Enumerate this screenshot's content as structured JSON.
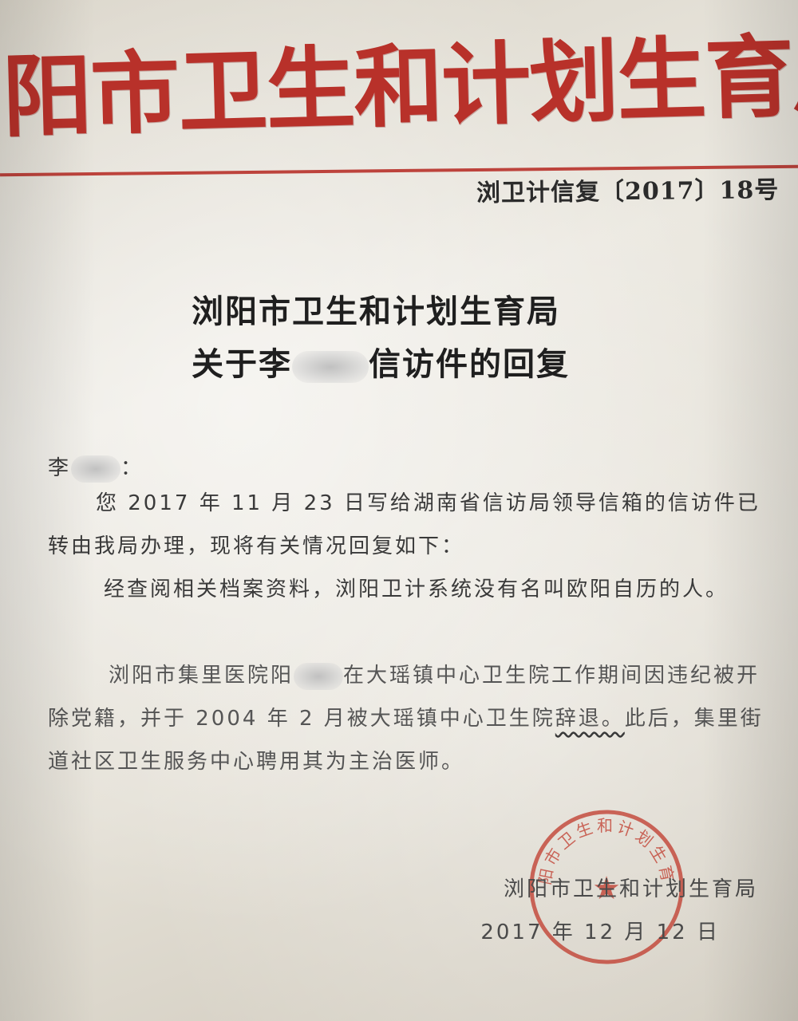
{
  "letterhead": {
    "agency_name": "浏阳市卫生和计划生育局",
    "doc_number": "浏卫计信复〔2017〕18号"
  },
  "title": {
    "line1": "浏阳市卫生和计划生育局",
    "line2_prefix": "关于李",
    "line2_suffix": "信访件的回复"
  },
  "body": {
    "salutation_name": "李",
    "salutation_punct": "：",
    "paragraph1": "您 2017 年 11 月 23 日写给湖南省信访局领导信箱的信访件已转由我局办理，现将有关情况回复如下：",
    "paragraph2": "经查阅相关档案资料，浏阳卫计系统没有名叫欧阳自历的人。",
    "paragraph3_before_blur": "浏阳市集里医院阳",
    "paragraph3_after_blur": "在大瑶镇中心卫生院工作期间因违纪被开除党籍，并于 2004 年 2 月被大瑶镇中心卫生院",
    "paragraph3_underlined": "辞退。",
    "paragraph3_end": "此后，集里街道社区卫生服务中心聘用其为主治医师。"
  },
  "closing": {
    "signature": "浏阳市卫生和计划生育局",
    "date": "2017 年 12 月 12 日"
  },
  "seal": {
    "text": "浏阳市卫生和计划生育局",
    "color": "#c0392b"
  },
  "colors": {
    "masthead_red": "#b8312a"
  }
}
